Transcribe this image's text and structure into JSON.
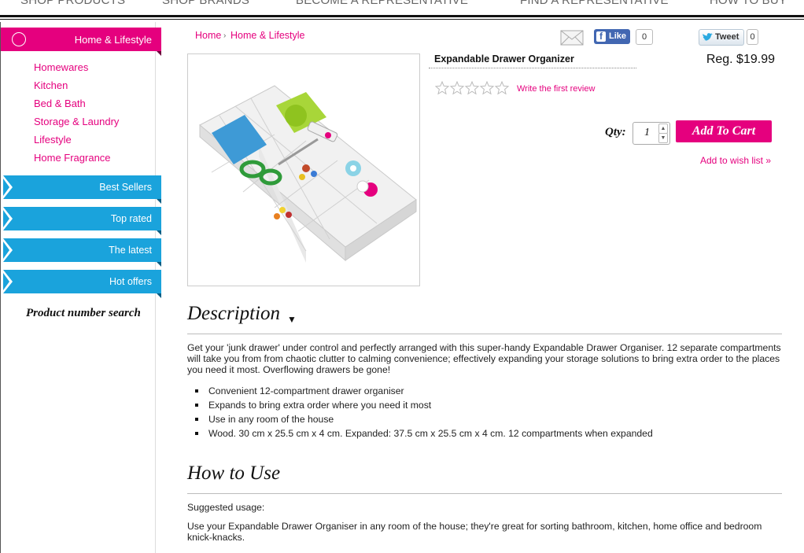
{
  "topnav": {
    "items": [
      "SHOP PRODUCTS",
      "SHOP BRANDS",
      "BECOME A REPRESENTATIVE",
      "FIND A REPRESENTATIVE",
      "HOW TO BUY"
    ]
  },
  "sidebar": {
    "category": "Home & Lifestyle",
    "subcategories": [
      "Homewares",
      "Kitchen",
      "Bed & Bath",
      "Storage & Laundry",
      "Lifestyle",
      "Home Fragrance"
    ],
    "tabs": [
      "Best Sellers",
      "Top rated",
      "The latest",
      "Hot offers"
    ],
    "product_number_search": "Product number search"
  },
  "breadcrumb": {
    "home": "Home",
    "category": "Home & Lifestyle"
  },
  "social": {
    "like_label": "Like",
    "like_count": "0",
    "tweet_label": "Tweet",
    "tweet_count": "0"
  },
  "product": {
    "title": "Expandable Drawer Organizer",
    "price": "Reg. $19.99",
    "rating_stars": 0,
    "review_link": "Write the first review",
    "qty_label": "Qty:",
    "qty_value": "1",
    "add_to_cart": "Add To Cart",
    "wishlist": "Add to wish list »"
  },
  "description": {
    "title": "Description",
    "text": "Get your 'junk drawer' under control and perfectly arranged with this super-handy Expandable Drawer Organiser. 12 separate compartments will take you from from chaotic clutter to calming convenience; effectively expanding your storage solutions to bring extra order to the places you need it most. Overflowing drawers be gone!",
    "bullets": [
      "Convenient 12-compartment drawer organiser",
      "Expands to bring extra order where you need it most",
      "Use in any room of the house",
      "Wood. 30 cm x 25.5 cm x 4 cm. Expanded: 37.5 cm x 25.5 cm x 4 cm. 12 compartments when expanded"
    ]
  },
  "how_to_use": {
    "title": "How to Use",
    "suggested": "Suggested usage:",
    "text": "Use your Expandable Drawer Organiser in any room of the house; they're great for sorting bathroom, kitchen, home office and bedroom knick-knacks."
  },
  "colors": {
    "accent": "#e5007e",
    "tab_blue": "#1aa3dc",
    "facebook": "#4267b2"
  }
}
